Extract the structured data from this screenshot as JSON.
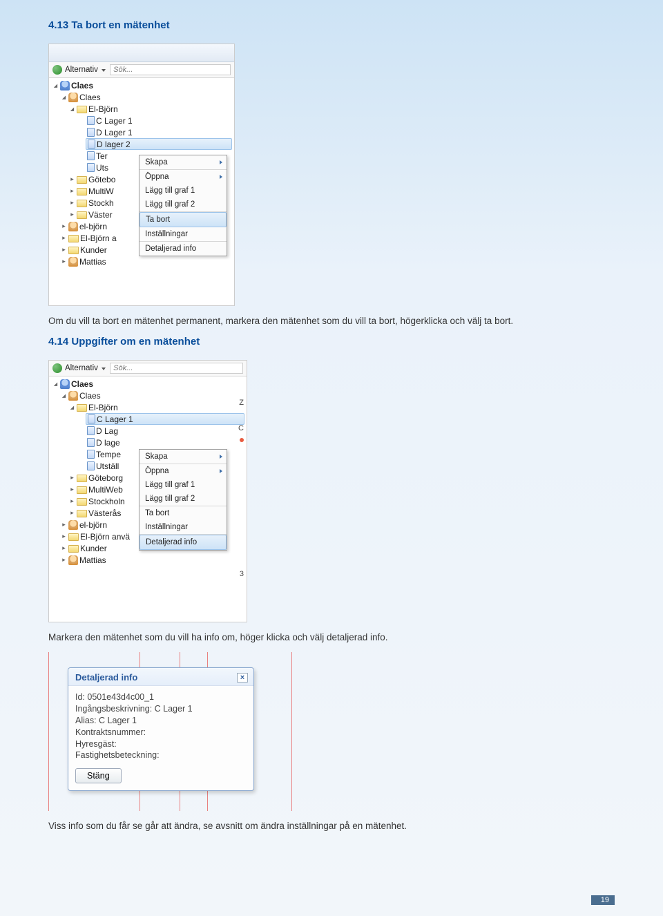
{
  "section1": {
    "heading": "4.13 Ta bort en mätenhet",
    "body": "Om du vill ta bort en mätenhet permanent, markera den mätenhet som du vill ta bort, högerklicka och välj ta bort."
  },
  "section2": {
    "heading": "4.14 Uppgifter om en mätenhet",
    "body": "Markera den mätenhet som du vill ha info om, höger klicka och välj detaljerad info."
  },
  "section3": {
    "body": "Viss info som du får se går att ändra, se avsnitt om ändra inställningar på en mätenhet."
  },
  "toolbar": {
    "alternativ": "Alternativ",
    "search_placeholder": "Sök..."
  },
  "tree1": {
    "root": "Claes",
    "claes": "Claes",
    "elbjorn": "El-Björn",
    "c1": "C Lager 1",
    "d1": "D Lager 1",
    "d2": "D lager 2",
    "ter": "Ter",
    "uts": "Uts",
    "gotebo": "Götebo",
    "multiw": "MultiW",
    "stockh": "Stockh",
    "vaster": "Väster",
    "elbjorn2": "el-björn",
    "elbjorna": "El-Björn a",
    "kunder": "Kunder",
    "mattias": "Mattias"
  },
  "tree2": {
    "root": "Claes",
    "claes": "Claes",
    "elbjorn": "El-Björn",
    "c1": "C Lager 1",
    "dlag": "D Lag",
    "dlage": "D lage",
    "tempe": "Tempe",
    "utstall": "Utställ",
    "goteborg": "Göteborg",
    "multiweb": "MultiWeb",
    "stockholm": "Stockholn",
    "vasteras": "Västerås",
    "elbjorn2": "el-björn",
    "elbjorna": "El-Björn anvä",
    "kunder": "Kunder",
    "mattias": "Mattias",
    "z": "Z",
    "c": "C",
    "n3": "3"
  },
  "context_menu": {
    "skapa": "Skapa",
    "oppna": "Öppna",
    "graf1": "Lägg till graf 1",
    "graf2": "Lägg till graf 2",
    "tabort": "Ta bort",
    "installningar": "Inställningar",
    "detaljerad": "Detaljerad info"
  },
  "dialog": {
    "title": "Detaljerad info",
    "id": "Id: 0501e43d4c00_1",
    "ing": "Ingångsbeskrivning: C Lager 1",
    "alias": "Alias: C Lager 1",
    "kontrakt": "Kontraktsnummer:",
    "hyres": "Hyresgäst:",
    "fastig": "Fastighetsbeteckning:",
    "stang": "Stäng"
  },
  "page_number": "19"
}
